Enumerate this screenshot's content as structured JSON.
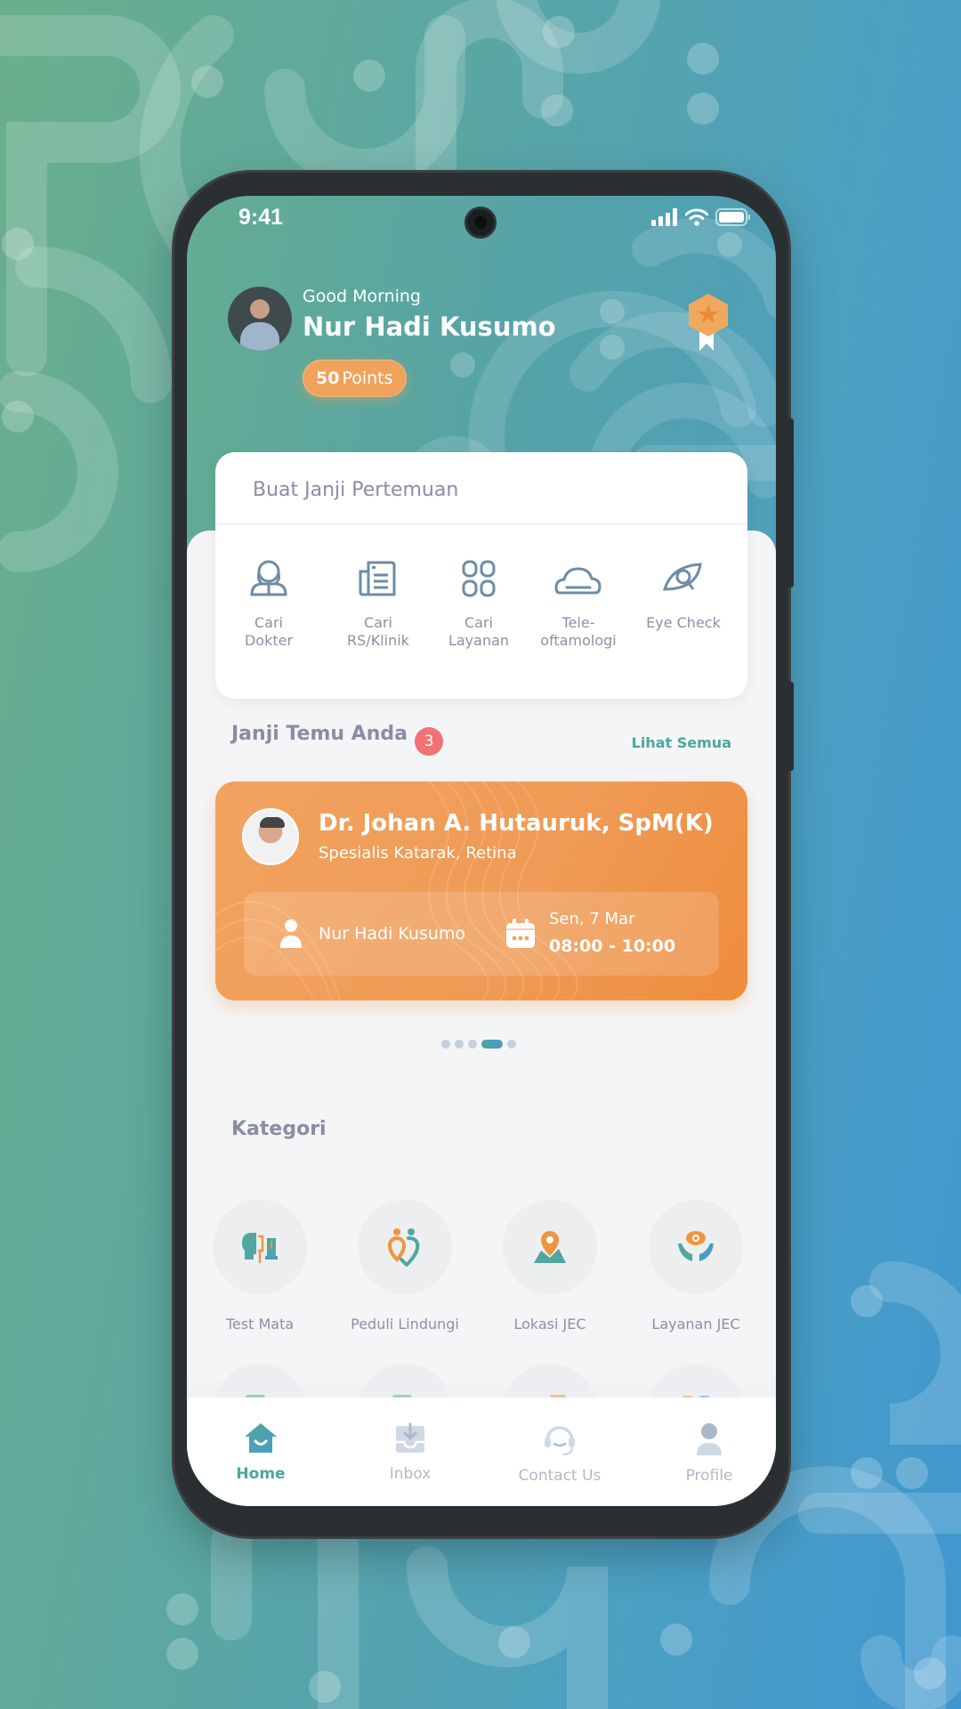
{
  "status_bar": {
    "time": "9:41"
  },
  "header": {
    "greeting": "Good Morning",
    "user_name": "Nur Hadi Kusumo",
    "points_value": "50",
    "points_label": "Points"
  },
  "appointment_panel": {
    "title": "Buat Janji Pertemuan",
    "actions": [
      {
        "label": "Cari\nDokter",
        "icon": "doctor-icon"
      },
      {
        "label": "Cari\nRS/Klinik",
        "icon": "hospital-list-icon"
      },
      {
        "label": "Cari\nLayanan",
        "icon": "grid-icon"
      },
      {
        "label": "Tele-\noftamologi",
        "icon": "cloud-icon"
      },
      {
        "label": "Eye Check",
        "icon": "eye-search-icon"
      }
    ]
  },
  "my_appointments": {
    "title": "Janji Temu Anda",
    "count": "3",
    "see_all": "Lihat Semua",
    "card": {
      "doctor_name": "Dr. Johan A. Hutauruk, SpM(K)",
      "specialty": "Spesialis Katarak, Retina",
      "patient": "Nur Hadi Kusumo",
      "date": "Sen, 7 Mar",
      "time": "08:00 - 10:00"
    },
    "carousel": {
      "total": 5,
      "active_index": 3
    }
  },
  "categories": {
    "title": "Kategori",
    "items": [
      {
        "label": "Test Mata",
        "icon": "eye-test-icon"
      },
      {
        "label": "Peduli Lindungi",
        "icon": "peduli-lindungi-icon"
      },
      {
        "label": "Lokasi JEC",
        "icon": "location-map-icon"
      },
      {
        "label": "Layanan JEC",
        "icon": "care-hands-icon"
      },
      {
        "label": "",
        "icon": "insurance-doc-icon"
      },
      {
        "label": "",
        "icon": "book-click-icon"
      },
      {
        "label": "",
        "icon": "consult-chat-icon"
      },
      {
        "label": "",
        "icon": "more-apps-icon"
      }
    ]
  },
  "bottom_nav": {
    "items": [
      {
        "label": "Home",
        "active": true
      },
      {
        "label": "Inbox",
        "active": false
      },
      {
        "label": "Contact Us",
        "active": false
      },
      {
        "label": "Profile",
        "active": false
      }
    ]
  },
  "colors": {
    "primary_teal": "#4ba79f",
    "accent_orange": "#f0a25a",
    "badge_red": "#f07276",
    "text_muted": "#8b8ca4"
  }
}
